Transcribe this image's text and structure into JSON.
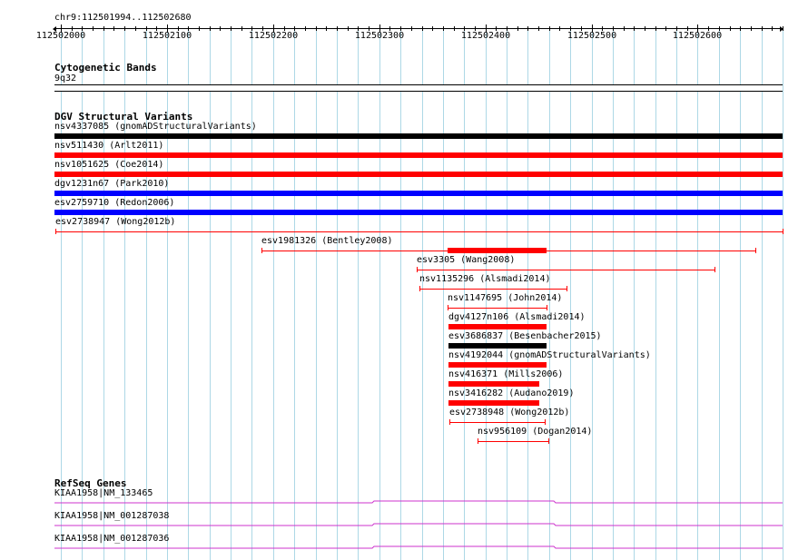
{
  "ruler": {
    "location": "chr9:112501994..112502680",
    "ticks": [
      "112502000",
      "112502100",
      "112502200",
      "112502300",
      "112502400",
      "112502500",
      "112502600"
    ]
  },
  "cytoband": {
    "header": "Cytogenetic Bands",
    "band": "9q32"
  },
  "dgv": {
    "header": "DGV Structural Variants",
    "tracks": [
      {
        "label": "nsv4337085 (gnomADStructuralVariants)",
        "color": "#000000",
        "style": "thick",
        "start": 112501994,
        "end": 112502680
      },
      {
        "label": "nsv511430 (Arlt2011)",
        "color": "#ff0000",
        "style": "thick",
        "start": 112501994,
        "end": 112502680
      },
      {
        "label": "nsv1051625 (Coe2014)",
        "color": "#ff0000",
        "style": "thick",
        "start": 112501994,
        "end": 112502680
      },
      {
        "label": "dgv1231n67 (Park2010)",
        "color": "#0000ff",
        "style": "thick",
        "start": 112501994,
        "end": 112502680
      },
      {
        "label": "esv2759710 (Redon2006)",
        "color": "#0000ff",
        "style": "thick",
        "start": 112501994,
        "end": 112502680
      },
      {
        "label": "esv2738947 (Wong2012b)",
        "color": "#ff0000",
        "style": "thin",
        "start": 112501995,
        "end": 112502680
      },
      {
        "label": "esv1981326 (Bentley2008)",
        "color": "#ff0000",
        "style": "thin",
        "start": 112502189,
        "end": 112502654,
        "thick_start": 112502364,
        "thick_end": 112502458
      },
      {
        "label": "esv3305 (Wang2008)",
        "color": "#ff0000",
        "style": "thin",
        "start": 112502335,
        "end": 112502616
      },
      {
        "label": "nsv1135296 (Alsmadi2014)",
        "color": "#ff0000",
        "style": "thin",
        "start": 112502338,
        "end": 112502476
      },
      {
        "label": "nsv1147695 (John2014)",
        "color": "#ff0000",
        "style": "thin",
        "start": 112502364,
        "end": 112502458
      },
      {
        "label": "dgv4127n106 (Alsmadi2014)",
        "color": "#ff0000",
        "style": "thick",
        "start": 112502365,
        "end": 112502458
      },
      {
        "label": "esv3686837 (Besenbacher2015)",
        "color": "#000000",
        "style": "thick",
        "start": 112502365,
        "end": 112502458
      },
      {
        "label": "nsv4192044 (gnomADStructuralVariants)",
        "color": "#ff0000",
        "style": "thick",
        "start": 112502365,
        "end": 112502458
      },
      {
        "label": "nsv416371 (Mills2006)",
        "color": "#ff0000",
        "style": "thick",
        "start": 112502365,
        "end": 112502451
      },
      {
        "label": "nsv3416282 (Audano2019)",
        "color": "#ff0000",
        "style": "thick",
        "start": 112502365,
        "end": 112502451
      },
      {
        "label": "esv2738948 (Wong2012b)",
        "color": "#ff0000",
        "style": "thin",
        "start": 112502366,
        "end": 112502456
      },
      {
        "label": "nsv956109 (Dogan2014)",
        "color": "#ff0000",
        "style": "thin",
        "start": 112502393,
        "end": 112502459
      }
    ]
  },
  "refseq": {
    "header": "RefSeq Genes",
    "genes": [
      {
        "label": "KIAA1958|NM_133465"
      },
      {
        "label": "KIAA1958|NM_001287038"
      },
      {
        "label": "KIAA1958|NM_001287036"
      }
    ],
    "line_color": "#cc33cc"
  },
  "colors": {
    "grid": "#add8e6",
    "ruler": "#000000"
  }
}
